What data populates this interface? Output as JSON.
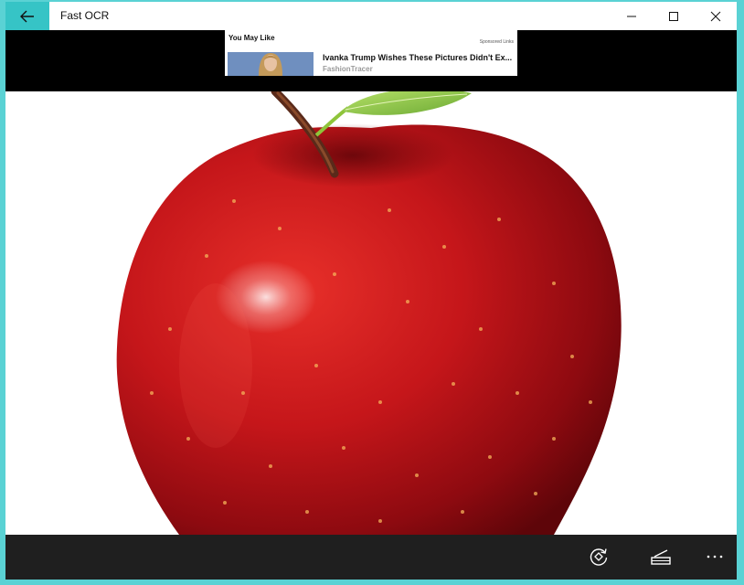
{
  "window": {
    "title": "Fast OCR"
  },
  "ad": {
    "heading": "You May Like",
    "sponsored": "Sponsored Links",
    "headline": "Ivanka Trump Wishes These Pictures Didn't Ex...",
    "source": "FashionTracer"
  },
  "image": {
    "subject-icon": "red-apple-photo"
  },
  "commandbar": {
    "icons": [
      "rotate-icon",
      "scan-icon",
      "more-icon"
    ]
  },
  "colors": {
    "accent": "#36c4c6",
    "frame": "#5ad2d4",
    "command_bar": "#1f1f1f"
  }
}
